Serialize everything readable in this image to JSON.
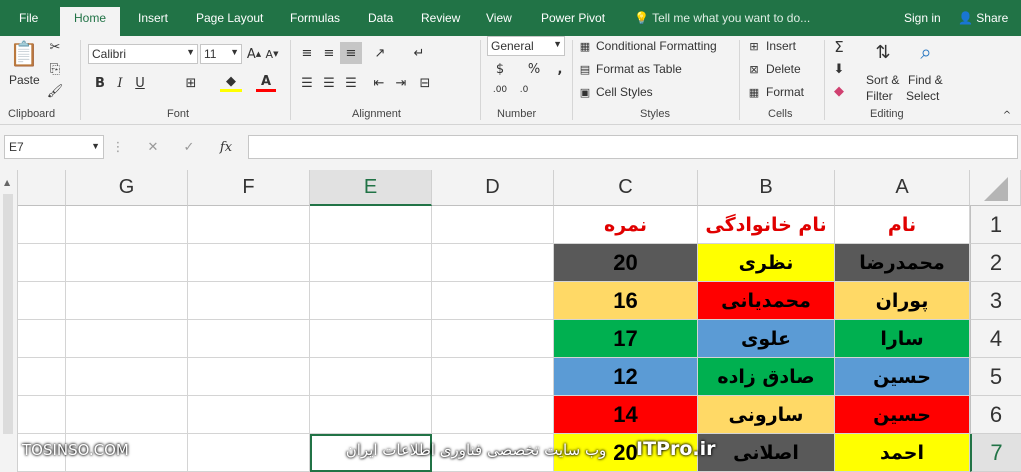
{
  "tabs": [
    "File",
    "Home",
    "Insert",
    "Page Layout",
    "Formulas",
    "Data",
    "Review",
    "View",
    "Power Pivot"
  ],
  "tell_me": "Tell me what you want to do...",
  "sign_in": "Sign in",
  "share": "Share",
  "clipboard": {
    "paste": "Paste",
    "label": "Clipboard"
  },
  "font": {
    "name": "Calibri",
    "size": "11",
    "label": "Font",
    "bold": "B",
    "italic": "I",
    "underline": "U"
  },
  "alignment": {
    "label": "Alignment"
  },
  "number": {
    "format": "General",
    "label": "Number",
    "dollar": "$",
    "percent": "%",
    "comma": ","
  },
  "styles": {
    "conditional": "Conditional Formatting",
    "table": "Format as Table",
    "cell_styles": "Cell Styles",
    "label": "Styles"
  },
  "cells": {
    "insert": "Insert",
    "delete": "Delete",
    "format": "Format",
    "label": "Cells"
  },
  "editing": {
    "sort1": "Sort &",
    "sort2": "Filter",
    "find1": "Find &",
    "find2": "Select",
    "label": "Editing"
  },
  "formula_bar": {
    "name_box": "E7",
    "fx": "fx",
    "formula": ""
  },
  "columns": [
    "A",
    "B",
    "C",
    "D",
    "E",
    "F",
    "G"
  ],
  "rows": [
    "1",
    "2",
    "3",
    "4",
    "5",
    "6",
    "7"
  ],
  "table": [
    {
      "a": "نام",
      "b": "نام خانوادگی",
      "c": "نمره"
    },
    {
      "a": "محمدرضا",
      "b": "نظری",
      "c": "20"
    },
    {
      "a": "پوران",
      "b": "محمدیانی",
      "c": "16"
    },
    {
      "a": "سارا",
      "b": "علوی",
      "c": "17"
    },
    {
      "a": "حسین",
      "b": "صادق زاده",
      "c": "12"
    },
    {
      "a": "حسین",
      "b": "سارونی",
      "c": "14"
    },
    {
      "a": "احمد",
      "b": "اصلانی",
      "c": "20"
    }
  ],
  "colors": {
    "header_text": "#e00000",
    "dark_gray": "#595959",
    "yellow": "#ffff00",
    "orange": "#ffd966",
    "red": "#ff0000",
    "green": "#00b050",
    "blue": "#5b9bd5",
    "excel_green": "#217346"
  },
  "watermark": {
    "left": "TOSINSO.COM",
    "right": "ITPro.ir",
    "middle": "وب سایت تخصصی فناوری اطلاعات ایران"
  }
}
